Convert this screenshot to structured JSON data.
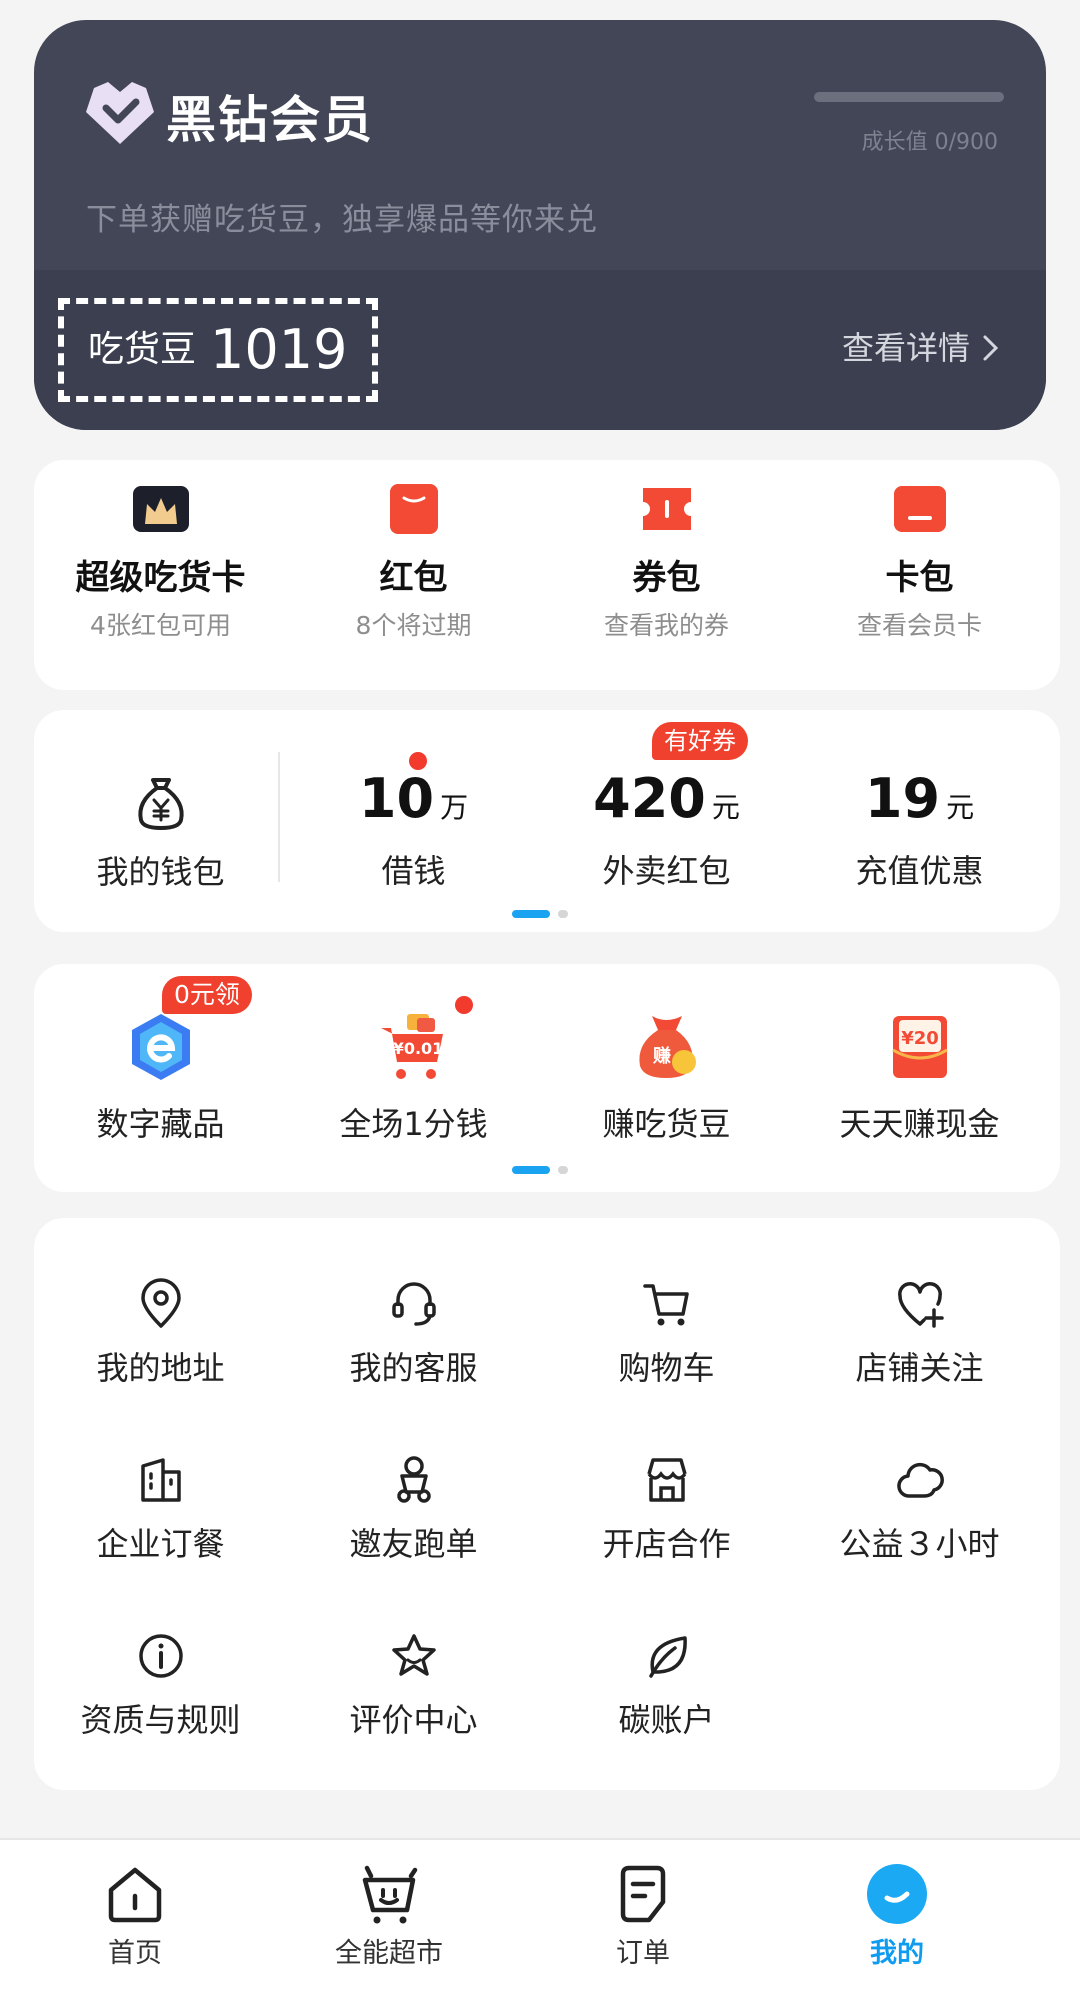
{
  "member": {
    "title": "黑钻会员",
    "growth": "成长值 0/900",
    "growth_progress": 0,
    "subtitle": "下单获赠吃货豆，独享爆品等你来兑",
    "beans_label": "吃货豆",
    "beans_value": "1019",
    "detail_link": "查看详情"
  },
  "assets": [
    {
      "icon": "crown-card-icon",
      "title": "超级吃货卡",
      "sub": "4张红包可用"
    },
    {
      "icon": "red-packet-icon",
      "title": "红包",
      "sub": "8个将过期"
    },
    {
      "icon": "coupon-icon",
      "title": "券包",
      "sub": "查看我的券"
    },
    {
      "icon": "card-icon",
      "title": "卡包",
      "sub": "查看会员卡"
    }
  ],
  "wallet": {
    "label": "我的钱包",
    "items": [
      {
        "value": "10",
        "unit": "万",
        "label": "借钱"
      },
      {
        "value": "420",
        "unit": "元",
        "label": "外卖红包",
        "tag": "有好券"
      },
      {
        "value": "19",
        "unit": "元",
        "label": "充值优惠"
      }
    ]
  },
  "promos": [
    {
      "icon": "digital-collection-icon",
      "label": "数字藏品",
      "tag": "0元领"
    },
    {
      "icon": "cart-penny-icon",
      "label": "全场1分钱",
      "badge_text": "¥0.01"
    },
    {
      "icon": "money-bag-icon",
      "label": "赚吃货豆",
      "badge_text": "赚"
    },
    {
      "icon": "cash-envelope-icon",
      "label": "天天赚现金",
      "badge_text": "¥20"
    }
  ],
  "tools": [
    {
      "icon": "location-icon",
      "label": "我的地址"
    },
    {
      "icon": "headset-icon",
      "label": "我的客服"
    },
    {
      "icon": "cart-icon",
      "label": "购物车"
    },
    {
      "icon": "heart-plus-icon",
      "label": "店铺关注"
    },
    {
      "icon": "building-icon",
      "label": "企业订餐"
    },
    {
      "icon": "scooter-rider-icon",
      "label": "邀友跑单"
    },
    {
      "icon": "storefront-icon",
      "label": "开店合作"
    },
    {
      "icon": "cloud-icon",
      "label": "公益３小时"
    },
    {
      "icon": "info-icon",
      "label": "资质与规则"
    },
    {
      "icon": "star-icon",
      "label": "评价中心"
    },
    {
      "icon": "leaf-icon",
      "label": "碳账户"
    }
  ],
  "nav": [
    {
      "icon": "home-icon",
      "label": "首页"
    },
    {
      "icon": "basket-icon",
      "label": "全能超市"
    },
    {
      "icon": "order-icon",
      "label": "订单"
    },
    {
      "icon": "profile-icon",
      "label": "我的",
      "active": true
    }
  ],
  "colors": {
    "member_bg": "#424656",
    "accent_blue": "#0f9cf0",
    "accent_red": "#f0412f"
  }
}
